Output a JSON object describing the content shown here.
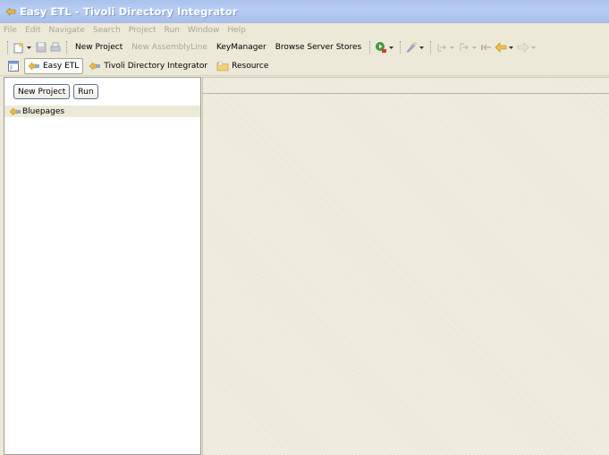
{
  "window": {
    "title": "Easy ETL - Tivoli Directory Integrator"
  },
  "menu": [
    {
      "label": "File"
    },
    {
      "label": "Edit"
    },
    {
      "label": "Navigate"
    },
    {
      "label": "Search"
    },
    {
      "label": "Project"
    },
    {
      "label": "Run"
    },
    {
      "label": "Window"
    },
    {
      "label": "Help"
    }
  ],
  "toolbar": {
    "new_project": "New Project",
    "new_assemblyline": "New AssemblyLine",
    "keymanager": "KeyManager",
    "browse_server_stores": "Browse Server Stores",
    "icons": [
      "new-wizard-icon",
      "save-icon",
      "print-icon",
      "run-icon",
      "search-icon",
      "next-annotation-icon",
      "prev-annotation-icon",
      "last-edit-icon",
      "back-icon",
      "forward-icon"
    ]
  },
  "perspectives": [
    {
      "label": "Easy ETL",
      "active": true,
      "icon": "easy-etl-icon"
    },
    {
      "label": "Tivoli Directory Integrator",
      "active": false,
      "icon": "tdi-icon"
    },
    {
      "label": "Resource",
      "active": false,
      "icon": "resource-folder-icon"
    }
  ],
  "left_panel": {
    "buttons": {
      "new_project": "New Project",
      "run": "Run"
    },
    "tree": [
      {
        "label": "Bluepages",
        "icon": "project-icon",
        "selected": true
      }
    ]
  },
  "colors": {
    "titlebar": "#a9c1ec",
    "chrome": "#ece9d8",
    "disabled_text": "#a7a69d"
  }
}
